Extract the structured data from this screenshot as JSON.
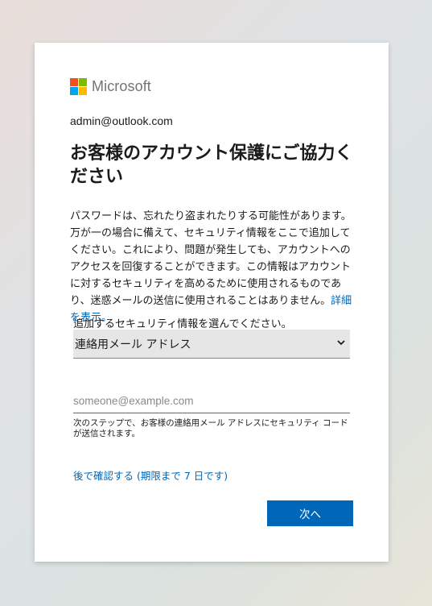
{
  "brand": {
    "name": "Microsoft",
    "logo_colors": [
      "#f25022",
      "#7fba00",
      "#00a4ef",
      "#ffb900"
    ]
  },
  "identity": "admin@outlook.com",
  "title": "お客様のアカウント保護にご協力ください",
  "description": {
    "text": "パスワードは、忘れたり盗まれたりする可能性があります。万が一の場合に備えて、セキュリティ情報をここで追加してください。これにより、問題が発生しても、アカウントへのアクセスを回復することができます。この情報はアカウントに対するセキュリティを高めるために使用されるものであり、迷惑メールの送信に使用されることはありません。",
    "link": "詳細を表示。"
  },
  "security_select": {
    "label": "追加するセキュリティ情報を選んでください。",
    "selected": "連絡用メール アドレス"
  },
  "email_field": {
    "value": "",
    "placeholder": "someone@example.com"
  },
  "hint": "次のステップで、お客様の連絡用メール アドレスにセキュリティ コードが送信されます。",
  "later_link": "後で確認する (期限まで 7 日です)",
  "next_button": "次へ",
  "colors": {
    "accent": "#0067b8"
  }
}
